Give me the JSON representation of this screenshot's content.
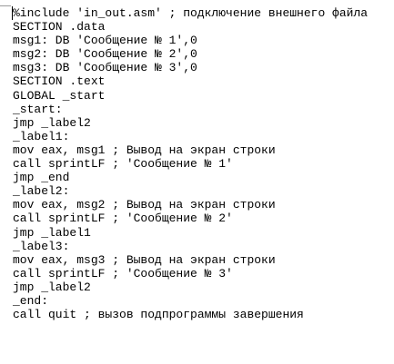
{
  "editor": {
    "lines": [
      "%include 'in_out.asm' ; подключение внешнего файла",
      "SECTION .data",
      "msg1: DB 'Сообщение № 1',0",
      "msg2: DB 'Сообщение № 2',0",
      "msg3: DB 'Сообщение № 3',0",
      "SECTION .text",
      "GLOBAL _start",
      "_start:",
      "jmp _label2",
      "_label1:",
      "mov eax, msg1 ; Вывод на экран строки",
      "call sprintLF ; 'Сообщение № 1'",
      "jmp _end",
      "_label2:",
      "mov eax, msg2 ; Вывод на экран строки",
      "call sprintLF ; 'Сообщение № 2'",
      "jmp _label1",
      "_label3:",
      "mov eax, msg3 ; Вывод на экран строки",
      "call sprintLF ; 'Сообщение № 3'",
      "jmp _label2",
      "_end:",
      "call quit ; вызов подпрограммы завершения"
    ]
  }
}
